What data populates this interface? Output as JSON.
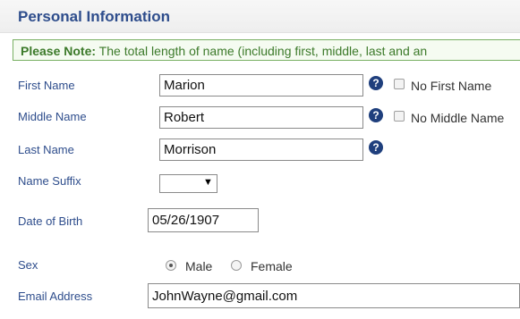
{
  "section": {
    "title": "Personal Information"
  },
  "note": {
    "prefix": "Please Note:",
    "text": " The total length of name (including first, middle, last and an"
  },
  "fields": {
    "first_name": {
      "label": "First Name",
      "value": "Marion",
      "checkbox_label": "No First Name"
    },
    "middle_name": {
      "label": "Middle Name",
      "value": "Robert",
      "checkbox_label": "No Middle Name"
    },
    "last_name": {
      "label": "Last Name",
      "value": "Morrison"
    },
    "name_suffix": {
      "label": "Name Suffix",
      "value": "",
      "arrow": "▼"
    },
    "date_of_birth": {
      "label": "Date of Birth",
      "value": "05/26/1907"
    },
    "sex": {
      "label": "Sex",
      "options": [
        "Male",
        "Female"
      ],
      "selected": "Male"
    },
    "email": {
      "label": "Email Address",
      "value": "JohnWayne@gmail.com"
    }
  },
  "help_glyph": "?",
  "colors": {
    "label": "#2e4d8c",
    "note_border": "#79b063",
    "note_text": "#3c7a2a",
    "help_icon": "#1f3f7d"
  }
}
